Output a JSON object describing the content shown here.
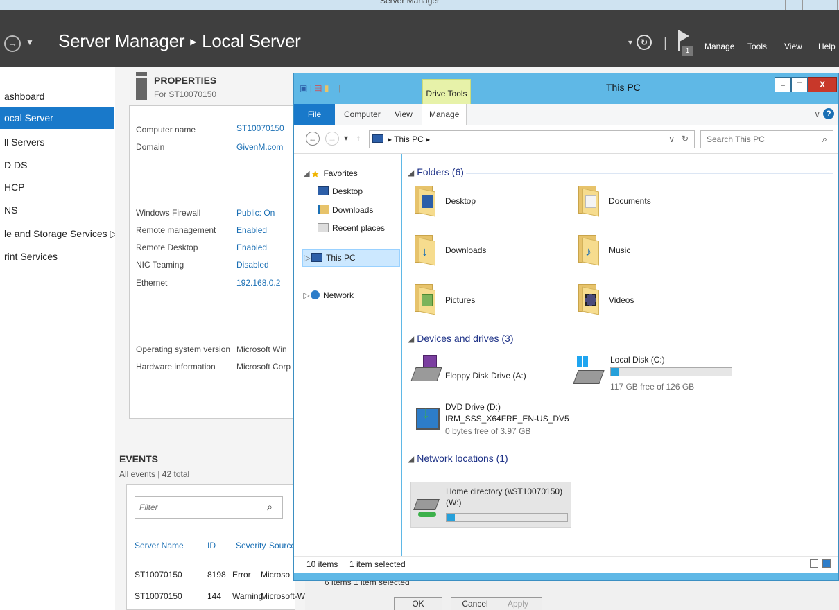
{
  "server_manager": {
    "window_title": "Server Manager",
    "breadcrumb": [
      "Server Manager",
      "Local Server"
    ],
    "notification_count": "1",
    "menu": [
      "Manage",
      "Tools",
      "View",
      "Help"
    ],
    "nav": [
      "ashboard",
      "ocal Server",
      "ll Servers",
      "D DS",
      "HCP",
      "NS",
      "le and Storage Services",
      "rint Services"
    ],
    "properties": {
      "title": "PROPERTIES",
      "subtitle": "For ST10070150",
      "rows": [
        {
          "label": "Computer name",
          "value": "ST10070150"
        },
        {
          "label": "Domain",
          "value": "GivenM.com"
        },
        {
          "label": "Windows Firewall",
          "value": "Public: On"
        },
        {
          "label": "Remote management",
          "value": "Enabled"
        },
        {
          "label": "Remote Desktop",
          "value": "Enabled"
        },
        {
          "label": "NIC Teaming",
          "value": "Disabled"
        },
        {
          "label": "Ethernet",
          "value": "192.168.0.2"
        },
        {
          "label": "Operating system version",
          "value": "Microsoft Win"
        },
        {
          "label": "Hardware information",
          "value": "Microsoft Corp"
        }
      ]
    },
    "events": {
      "title": "EVENTS",
      "subtitle": "All events | 42 total",
      "filter_placeholder": "Filter",
      "columns": [
        "Server Name",
        "ID",
        "Severity",
        "Source"
      ],
      "rows": [
        [
          "ST10070150",
          "8198",
          "Error",
          "Microso"
        ],
        [
          "ST10070150",
          "144",
          "Warning",
          "Microsoft-W"
        ]
      ]
    }
  },
  "background_dialog": {
    "status": "6 items    1 item selected",
    "buttons": [
      "OK",
      "Cancel",
      "Apply"
    ]
  },
  "explorer": {
    "title": "This PC",
    "context_tab": "Drive Tools",
    "tabs": [
      "File",
      "Computer",
      "View",
      "Manage"
    ],
    "address_path": "This PC",
    "search_placeholder": "Search This PC",
    "nav": {
      "favorites": "Favorites",
      "desktop": "Desktop",
      "downloads": "Downloads",
      "recent": "Recent places",
      "this_pc": "This PC",
      "network": "Network"
    },
    "folders_group": "Folders (6)",
    "folders": [
      "Desktop",
      "Documents",
      "Downloads",
      "Music",
      "Pictures",
      "Videos"
    ],
    "devices_group": "Devices and drives (3)",
    "floppy": "Floppy Disk Drive (A:)",
    "local_disk": {
      "name": "Local Disk (C:)",
      "free": "117 GB free of 126 GB",
      "used_fraction": 0.07
    },
    "dvd": {
      "name": "DVD Drive (D:)",
      "label": "IRM_SSS_X64FRE_EN-US_DV5",
      "free": "0 bytes free of 3.97 GB"
    },
    "network_group": "Network locations (1)",
    "home": {
      "name_line1": "Home directory (\\\\ST10070150)",
      "name_line2": "(W:)",
      "used_fraction": 0.07
    },
    "status_items": "10 items",
    "status_selected": "1 item selected"
  }
}
